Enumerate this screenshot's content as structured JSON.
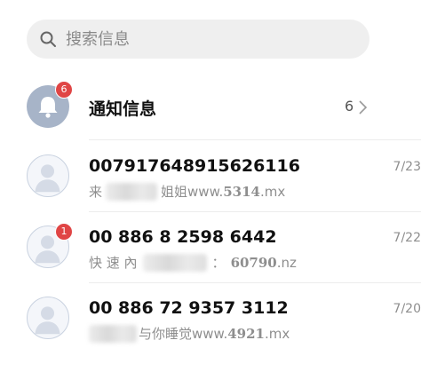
{
  "search": {
    "placeholder": "搜索信息"
  },
  "notification": {
    "title": "通知信息",
    "badge": "6",
    "count": "6"
  },
  "messages": [
    {
      "sender": "007917648915626116",
      "preview_prefix": "来",
      "preview_mid": "姐姐",
      "preview_url_prefix": " www.",
      "preview_url_num": "5314",
      "preview_url_suffix": ".mx",
      "date": "7/23",
      "badge": ""
    },
    {
      "sender": "00 886 8 2598 6442",
      "preview_prefix": "快 速 內",
      "preview_mid": "：",
      "preview_url_prefix": "",
      "preview_url_num": "60790",
      "preview_url_suffix": ".nz",
      "date": "7/22",
      "badge": "1"
    },
    {
      "sender": "00 886 72 9357 3112",
      "preview_prefix": "",
      "preview_mid": "与你睡觉",
      "preview_url_prefix": " www.",
      "preview_url_num": "4921",
      "preview_url_suffix": ".mx",
      "date": "7/20",
      "badge": ""
    }
  ],
  "colors": {
    "accent_badge": "#e04545",
    "bell_avatar": "#a7b4c8"
  }
}
